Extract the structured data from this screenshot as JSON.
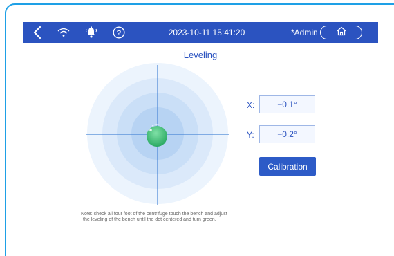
{
  "header": {
    "datetime": "2023-10-11 15:41:20",
    "user": "*Admin",
    "icons": [
      "back-icon",
      "wifi-icon",
      "alarm-bell-icon",
      "help-icon",
      "home-icon"
    ]
  },
  "page": {
    "title": "Leveling"
  },
  "leveling": {
    "x_label": "X:",
    "x_value": "−0.1°",
    "y_label": "Y:",
    "y_value": "−0.2°",
    "calibration_label": "Calibration",
    "bubble_state": "green"
  },
  "note": {
    "line1": "Note: check all four foot of the centrifuge touch the bench and adjust",
    "line2": "the leveling of the bench until the dot centered and turn green."
  },
  "colors": {
    "header_bg": "#2b53c0",
    "accent": "#2b53c0",
    "frame_border": "#1ea0e6",
    "bubble": "#2fb56a"
  }
}
